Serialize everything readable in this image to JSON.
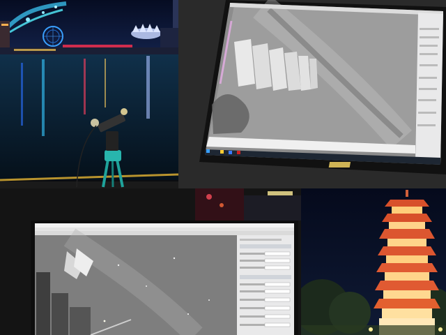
{
  "collage": {
    "photos": [
      {
        "subject": "night-harbor-with-tripod-mount"
      },
      {
        "subject": "laptop-astro-capture-pagoda"
      },
      {
        "subject": "laptop-astro-capture-skyline"
      },
      {
        "subject": "illuminated-pagoda-night"
      }
    ]
  },
  "colors": {
    "night_sky": "#0a1430",
    "water": "#0d2a3e",
    "pagoda_glow": "#e0502a",
    "lantern_yellow": "#ffd27a",
    "mount_teal": "#1fa39b",
    "screen_bg": "#9a9a9a",
    "ui_panel": "#e9e9ea"
  }
}
